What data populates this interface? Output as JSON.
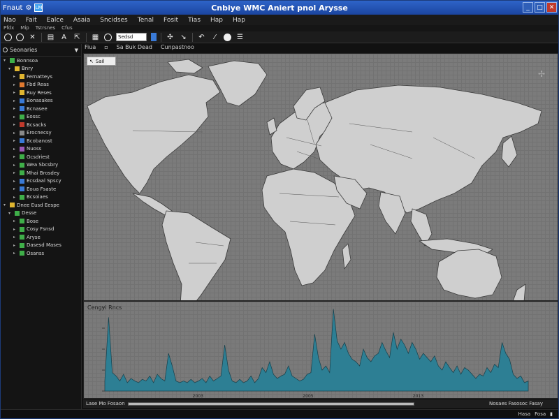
{
  "window": {
    "app_label": "Fnaut",
    "app_badge": "LM",
    "title": "Cnbiye WMC Aniert pnol Arysse"
  },
  "menu": [
    "Nao",
    "Fait",
    "Ealce",
    "Asaia",
    "Sncidses",
    "Tenal",
    "Fosit",
    "Tias",
    "Hap",
    "Hap"
  ],
  "submenu": [
    "Pfdx",
    "Mip",
    "Tstrsnes",
    "Cfus"
  ],
  "toolbar": {
    "search_value": "Sedsd"
  },
  "addressbar": [
    "Fiua",
    "Sa Buk Dead",
    "Cunpastnoo"
  ],
  "sidebar": {
    "header": "Seonaries",
    "tree": [
      {
        "label": "Bonnsoa",
        "color": "#3fae49",
        "indent": 0
      },
      {
        "label": "Bnry",
        "color": "#e0b530",
        "indent": 1
      },
      {
        "label": "Fernatteys",
        "color": "#e0b530",
        "indent": 2
      },
      {
        "label": "Fbd Reas",
        "color": "#e07a30",
        "indent": 2
      },
      {
        "label": "Ruy Reses",
        "color": "#e0b530",
        "indent": 2
      },
      {
        "label": "Bonasakes",
        "color": "#3a7ad6",
        "indent": 2
      },
      {
        "label": "Bcnasee",
        "color": "#3a7ad6",
        "indent": 2
      },
      {
        "label": "Eossc",
        "color": "#3fae49",
        "indent": 2
      },
      {
        "label": "Bcsacks",
        "color": "#c0392b",
        "indent": 2
      },
      {
        "label": "Erocnecsy",
        "color": "#8a8a8a",
        "indent": 2
      },
      {
        "label": "Bcobanost",
        "color": "#3a7ad6",
        "indent": 2
      },
      {
        "label": "Nuoss",
        "color": "#9b59b6",
        "indent": 2
      },
      {
        "label": "Gcsdriest",
        "color": "#3fae49",
        "indent": 2
      },
      {
        "label": "Wea Sbcsbry",
        "color": "#3fae49",
        "indent": 2
      },
      {
        "label": "Mhai Brosdey",
        "color": "#3fae49",
        "indent": 2
      },
      {
        "label": "Ecsdaal Spscy",
        "color": "#3a7ad6",
        "indent": 2
      },
      {
        "label": "Eoua Fsaste",
        "color": "#3a7ad6",
        "indent": 2
      },
      {
        "label": "Bcsoiaes",
        "color": "#3fae49",
        "indent": 2
      },
      {
        "label": "Dnee Eusd Eespe",
        "color": "#e0b530",
        "indent": 0
      },
      {
        "label": "Desse",
        "color": "#3fae49",
        "indent": 1
      },
      {
        "label": "Bose",
        "color": "#3fae49",
        "indent": 2
      },
      {
        "label": "Cosy Fsnsd",
        "color": "#3fae49",
        "indent": 2
      },
      {
        "label": "Aryse",
        "color": "#3fae49",
        "indent": 2
      },
      {
        "label": "Dasesd Mases",
        "color": "#3fae49",
        "indent": 2
      },
      {
        "label": "Osanss",
        "color": "#3fae49",
        "indent": 2
      }
    ]
  },
  "map": {
    "tag": "Sail"
  },
  "chart_data": {
    "type": "area",
    "title": "Cengyi Rncs",
    "xlabel": "",
    "ylabel": "",
    "x_ticks": [
      "2003",
      "2005",
      "2013"
    ],
    "color": "#2d7f94",
    "values": [
      0.12,
      0.88,
      0.22,
      0.18,
      0.12,
      0.2,
      0.1,
      0.15,
      0.12,
      0.1,
      0.14,
      0.12,
      0.18,
      0.1,
      0.2,
      0.15,
      0.12,
      0.45,
      0.3,
      0.12,
      0.1,
      0.12,
      0.1,
      0.14,
      0.1,
      0.12,
      0.15,
      0.1,
      0.18,
      0.12,
      0.15,
      0.18,
      0.55,
      0.25,
      0.12,
      0.1,
      0.14,
      0.1,
      0.12,
      0.18,
      0.1,
      0.15,
      0.28,
      0.22,
      0.35,
      0.2,
      0.15,
      0.18,
      0.2,
      0.3,
      0.18,
      0.15,
      0.12,
      0.14,
      0.2,
      0.22,
      0.68,
      0.4,
      0.25,
      0.3,
      0.22,
      0.98,
      0.6,
      0.5,
      0.58,
      0.45,
      0.38,
      0.35,
      0.3,
      0.5,
      0.4,
      0.35,
      0.42,
      0.45,
      0.58,
      0.48,
      0.4,
      0.7,
      0.5,
      0.62,
      0.55,
      0.45,
      0.58,
      0.5,
      0.38,
      0.45,
      0.4,
      0.35,
      0.42,
      0.3,
      0.25,
      0.35,
      0.28,
      0.22,
      0.3,
      0.2,
      0.28,
      0.25,
      0.2,
      0.15,
      0.2,
      0.18,
      0.28,
      0.22,
      0.32,
      0.28,
      0.58,
      0.45,
      0.38,
      0.2,
      0.15,
      0.18,
      0.1,
      0.12
    ]
  },
  "timeline": {
    "left": "Lase Mo Fosaon",
    "right": "Nosaes Fasosoc Fasay"
  },
  "status": [
    "Hasa",
    "Fosa"
  ]
}
